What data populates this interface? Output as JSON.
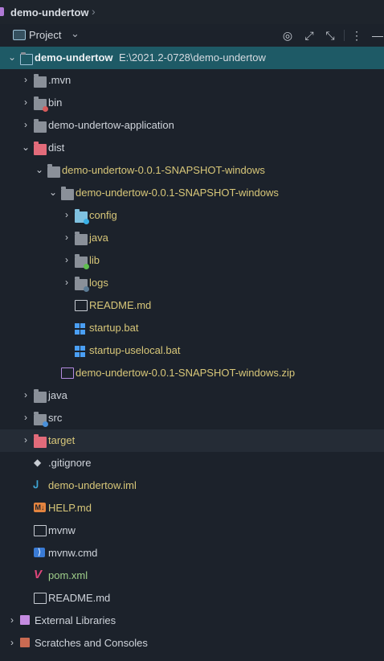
{
  "title_bar": {
    "project": "demo-undertow",
    "chevron": "›"
  },
  "toolbar": {
    "view_label": "Project",
    "dropdown": "⌄",
    "buttons": [
      "◎",
      "⤢",
      "⤡",
      "⋮",
      "—"
    ]
  },
  "tree": [
    {
      "depth": 0,
      "arrow": "⌄",
      "icon": "module-folder-icon",
      "label": "demo-undertow",
      "path": "E:\\2021.2-0728\\demo-undertow",
      "selected": true
    },
    {
      "depth": 1,
      "arrow": "›",
      "icon": "folder-icon",
      "label": ".mvn"
    },
    {
      "depth": 1,
      "arrow": "›",
      "icon": "excluded-folder-icon",
      "label": "bin"
    },
    {
      "depth": 1,
      "arrow": "›",
      "icon": "folder-icon",
      "label": "demo-undertow-application"
    },
    {
      "depth": 1,
      "arrow": "⌄",
      "icon": "red-folder-icon",
      "label": "dist"
    },
    {
      "depth": 2,
      "arrow": "⌄",
      "icon": "folder-icon",
      "label": "demo-undertow-0.0.1-SNAPSHOT-windows",
      "color": "yellow"
    },
    {
      "depth": 3,
      "arrow": "⌄",
      "icon": "folder-icon",
      "label": "demo-undertow-0.0.1-SNAPSHOT-windows",
      "color": "yellow"
    },
    {
      "depth": 4,
      "arrow": "›",
      "icon": "config-folder-icon",
      "label": "config",
      "color": "yellow"
    },
    {
      "depth": 4,
      "arrow": "›",
      "icon": "folder-icon",
      "label": "java",
      "color": "yellow"
    },
    {
      "depth": 4,
      "arrow": "›",
      "icon": "lib-folder-icon",
      "label": "lib",
      "color": "yellow"
    },
    {
      "depth": 4,
      "arrow": "›",
      "icon": "logs-folder-icon",
      "label": "logs",
      "color": "yellow"
    },
    {
      "depth": 4,
      "arrow": "",
      "icon": "readme-file-icon",
      "label": "README.md",
      "color": "yellow"
    },
    {
      "depth": 4,
      "arrow": "",
      "icon": "windows-icon",
      "label": "startup.bat",
      "color": "yellow"
    },
    {
      "depth": 4,
      "arrow": "",
      "icon": "windows-icon",
      "label": "startup-uselocal.bat",
      "color": "yellow"
    },
    {
      "depth": 3,
      "arrow": "",
      "icon": "zip-file-icon",
      "label": "demo-undertow-0.0.1-SNAPSHOT-windows.zip",
      "color": "yellow"
    },
    {
      "depth": 1,
      "arrow": "›",
      "icon": "folder-icon",
      "label": "java"
    },
    {
      "depth": 1,
      "arrow": "›",
      "icon": "source-folder-icon",
      "label": "src"
    },
    {
      "depth": 1,
      "arrow": "›",
      "icon": "red-folder-icon",
      "label": "target",
      "color": "yellow",
      "highlight": true
    },
    {
      "depth": 1,
      "arrow": "",
      "icon": "git-icon",
      "label": ".gitignore"
    },
    {
      "depth": 1,
      "arrow": "",
      "icon": "iml-icon",
      "label": "demo-undertow.iml",
      "color": "yellow"
    },
    {
      "depth": 1,
      "arrow": "",
      "icon": "markdown-icon",
      "label": "HELP.md",
      "color": "yellow"
    },
    {
      "depth": 1,
      "arrow": "",
      "icon": "file-icon",
      "label": "mvnw"
    },
    {
      "depth": 1,
      "arrow": "",
      "icon": "cmd-icon",
      "label": "mvnw.cmd"
    },
    {
      "depth": 1,
      "arrow": "",
      "icon": "maven-icon",
      "label": "pom.xml",
      "color": "green"
    },
    {
      "depth": 1,
      "arrow": "",
      "icon": "readme-file-icon",
      "label": "README.md"
    },
    {
      "depth": 0,
      "arrow": "›",
      "icon": "libraries-icon",
      "label": "External Libraries"
    },
    {
      "depth": 0,
      "arrow": "›",
      "icon": "scratches-icon",
      "label": "Scratches and Consoles"
    }
  ],
  "colors": {
    "selection": "#1e5a66",
    "background": "#1c222b",
    "highlight": "#252c36"
  }
}
